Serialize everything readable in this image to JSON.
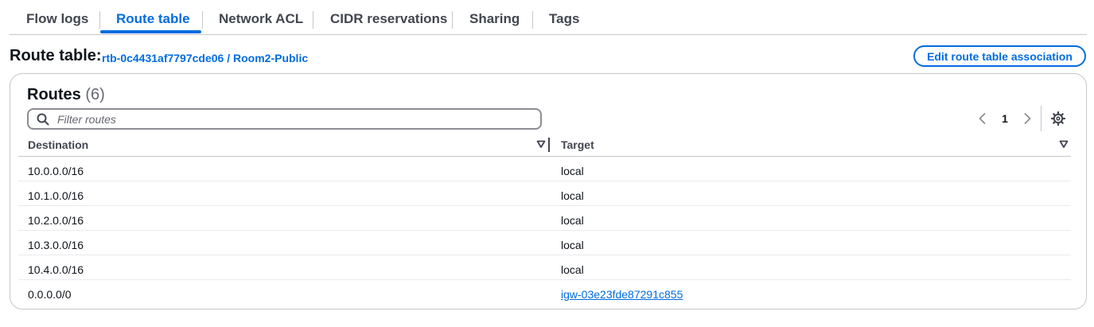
{
  "tabs": [
    {
      "label": "Flow logs"
    },
    {
      "label": "Route table"
    },
    {
      "label": "Network ACL"
    },
    {
      "label": "CIDR reservations"
    },
    {
      "label": "Sharing"
    },
    {
      "label": "Tags"
    }
  ],
  "active_tab": "Route table",
  "route_table": {
    "title": "Route table:",
    "link": "rtb-0c4431af7797cde06 / Room2-Public",
    "edit_button": "Edit route table association"
  },
  "routes": {
    "title": "Routes",
    "count": "(6)",
    "filter_placeholder": "Filter routes",
    "filter_value": "",
    "page": "1",
    "columns": [
      "Destination",
      "Target"
    ],
    "rows": [
      {
        "destination": "10.0.0.0/16",
        "target": "local"
      },
      {
        "destination": "10.1.0.0/16",
        "target": "local"
      },
      {
        "destination": "10.2.0.0/16",
        "target": "local"
      },
      {
        "destination": "10.3.0.0/16",
        "target": "local"
      },
      {
        "destination": "10.4.0.0/16",
        "target": "local"
      },
      {
        "destination": "0.0.0.0/0",
        "target": "igw-03e23fde87291c855",
        "target_is_link": true
      }
    ]
  },
  "icons": {
    "filter": "search-icon",
    "prev": "chevron-left-icon",
    "next": "chevron-right-icon",
    "settings": "gear-icon",
    "sort": "sort-down-icon"
  },
  "colors": {
    "accent": "#006ce0",
    "text": "#0f141a",
    "muted": "#424650",
    "border": "#c6c6cd"
  }
}
